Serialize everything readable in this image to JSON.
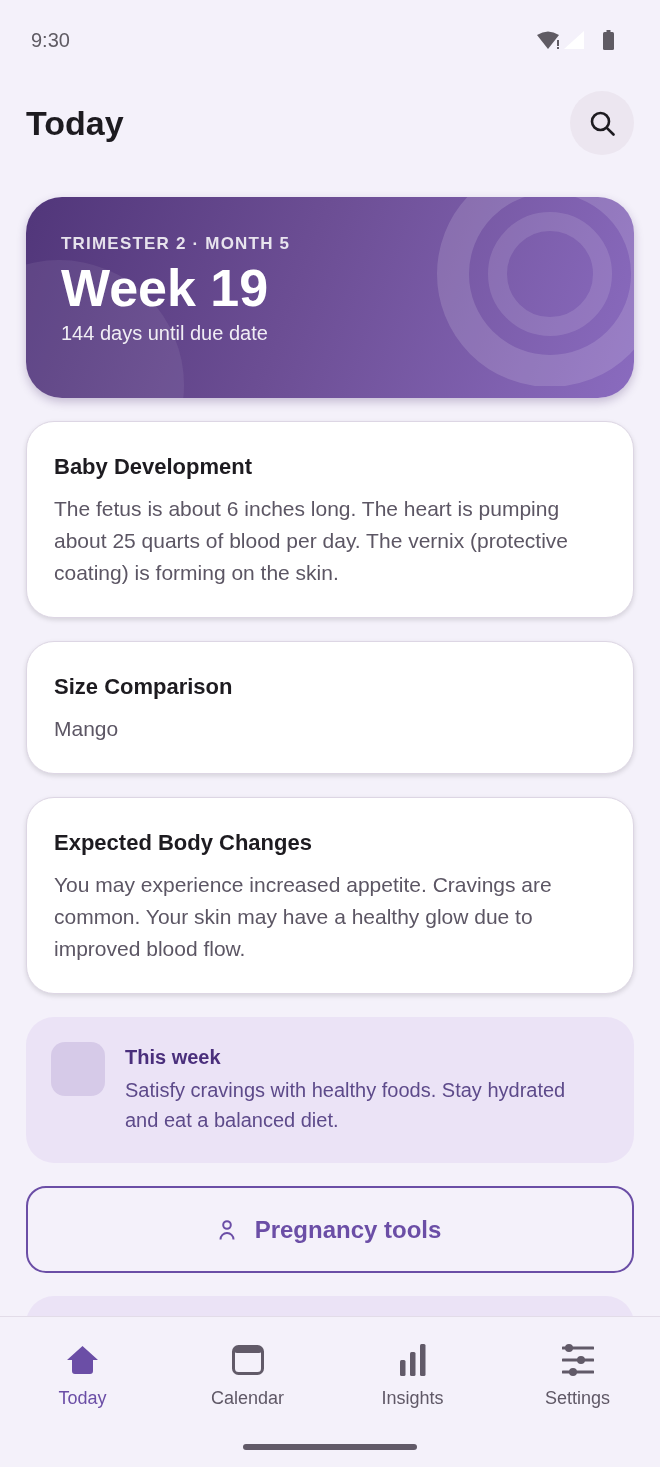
{
  "status_bar": {
    "time": "9:30"
  },
  "header": {
    "title": "Today"
  },
  "hero": {
    "overline": "TRIMESTER 2 · MONTH 5",
    "title": "Week 19",
    "subtitle": "144 days until due date"
  },
  "cards": [
    {
      "title": "Baby Development",
      "body": "The fetus is about 6 inches long. The heart is pumping about 25 quarts of blood per day. The vernix (protective coating) is forming on the skin."
    },
    {
      "title": "Size Comparison",
      "body": "Mango"
    },
    {
      "title": "Expected Body Changes",
      "body": "You may experience increased appetite. Cravings are common. Your skin may have a healthy glow due to improved blood flow."
    }
  ],
  "tip": {
    "title": "This week",
    "body": "Satisfy cravings with healthy foods. Stay hydrated and eat a balanced diet."
  },
  "tools_button": {
    "label": "Pregnancy tools"
  },
  "bottom_nav": [
    {
      "label": "Today",
      "selected": true
    },
    {
      "label": "Calendar",
      "selected": false
    },
    {
      "label": "Insights",
      "selected": false
    },
    {
      "label": "Settings",
      "selected": false
    }
  ]
}
